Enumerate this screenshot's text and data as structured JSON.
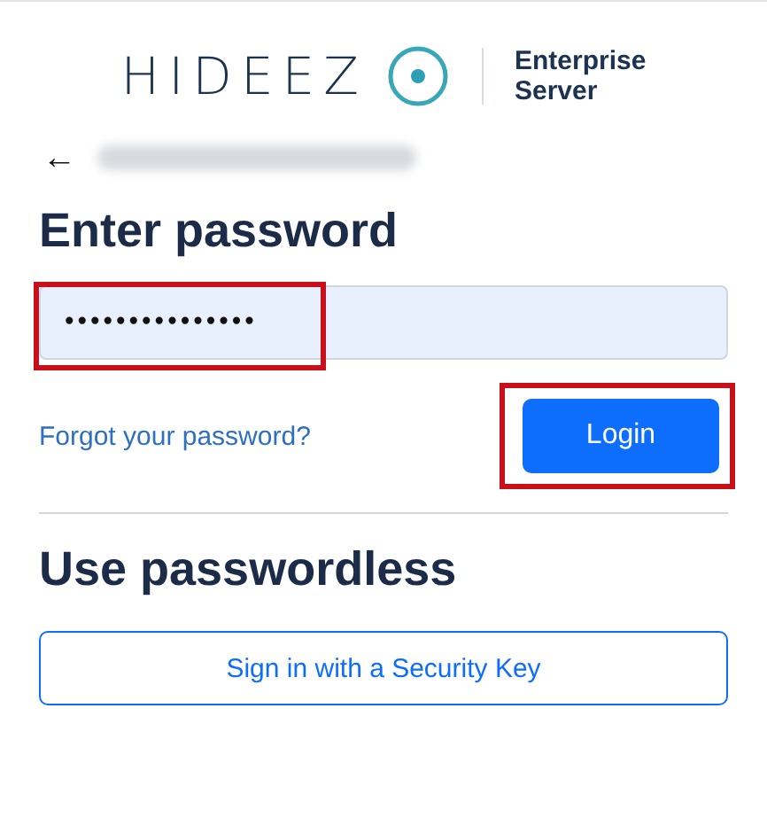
{
  "logo": {
    "wordmark": "HIDEEZ",
    "product_line1": "Enterprise",
    "product_line2": "Server"
  },
  "back_button": {
    "label": "←"
  },
  "heading": "Enter password",
  "password": {
    "value": "•••••••••••••••",
    "highlighted": true
  },
  "forgot_link": "Forgot your password?",
  "login_button": {
    "label": "Login",
    "highlighted": true
  },
  "passwordless_heading": "Use passwordless",
  "security_key_button": "Sign in with a Security Key"
}
